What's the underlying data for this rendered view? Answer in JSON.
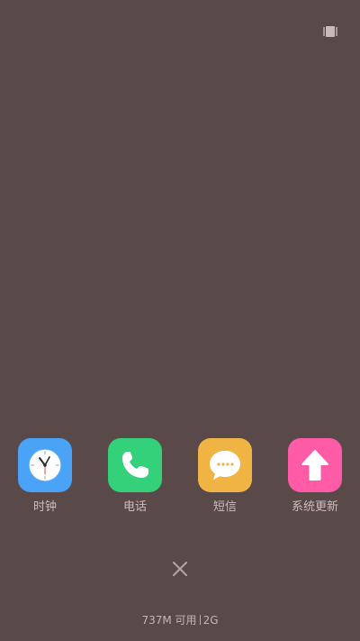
{
  "colors": {
    "background": "#5a4949",
    "clock": "#4aa3f6",
    "phone": "#34d17a",
    "messages": "#f0b445",
    "update": "#ff5ba7",
    "label": "#cbbdbd"
  },
  "top_right": {
    "icon": "multitask-icon"
  },
  "recent_apps": [
    {
      "label": "时钟",
      "icon": "clock-icon"
    },
    {
      "label": "电话",
      "icon": "phone-icon"
    },
    {
      "label": "短信",
      "icon": "message-icon"
    },
    {
      "label": "系统更新",
      "icon": "upload-arrow-icon"
    }
  ],
  "close": {
    "icon": "close-icon"
  },
  "status": {
    "memory_available": "737M 可用",
    "memory_total": "2G"
  }
}
